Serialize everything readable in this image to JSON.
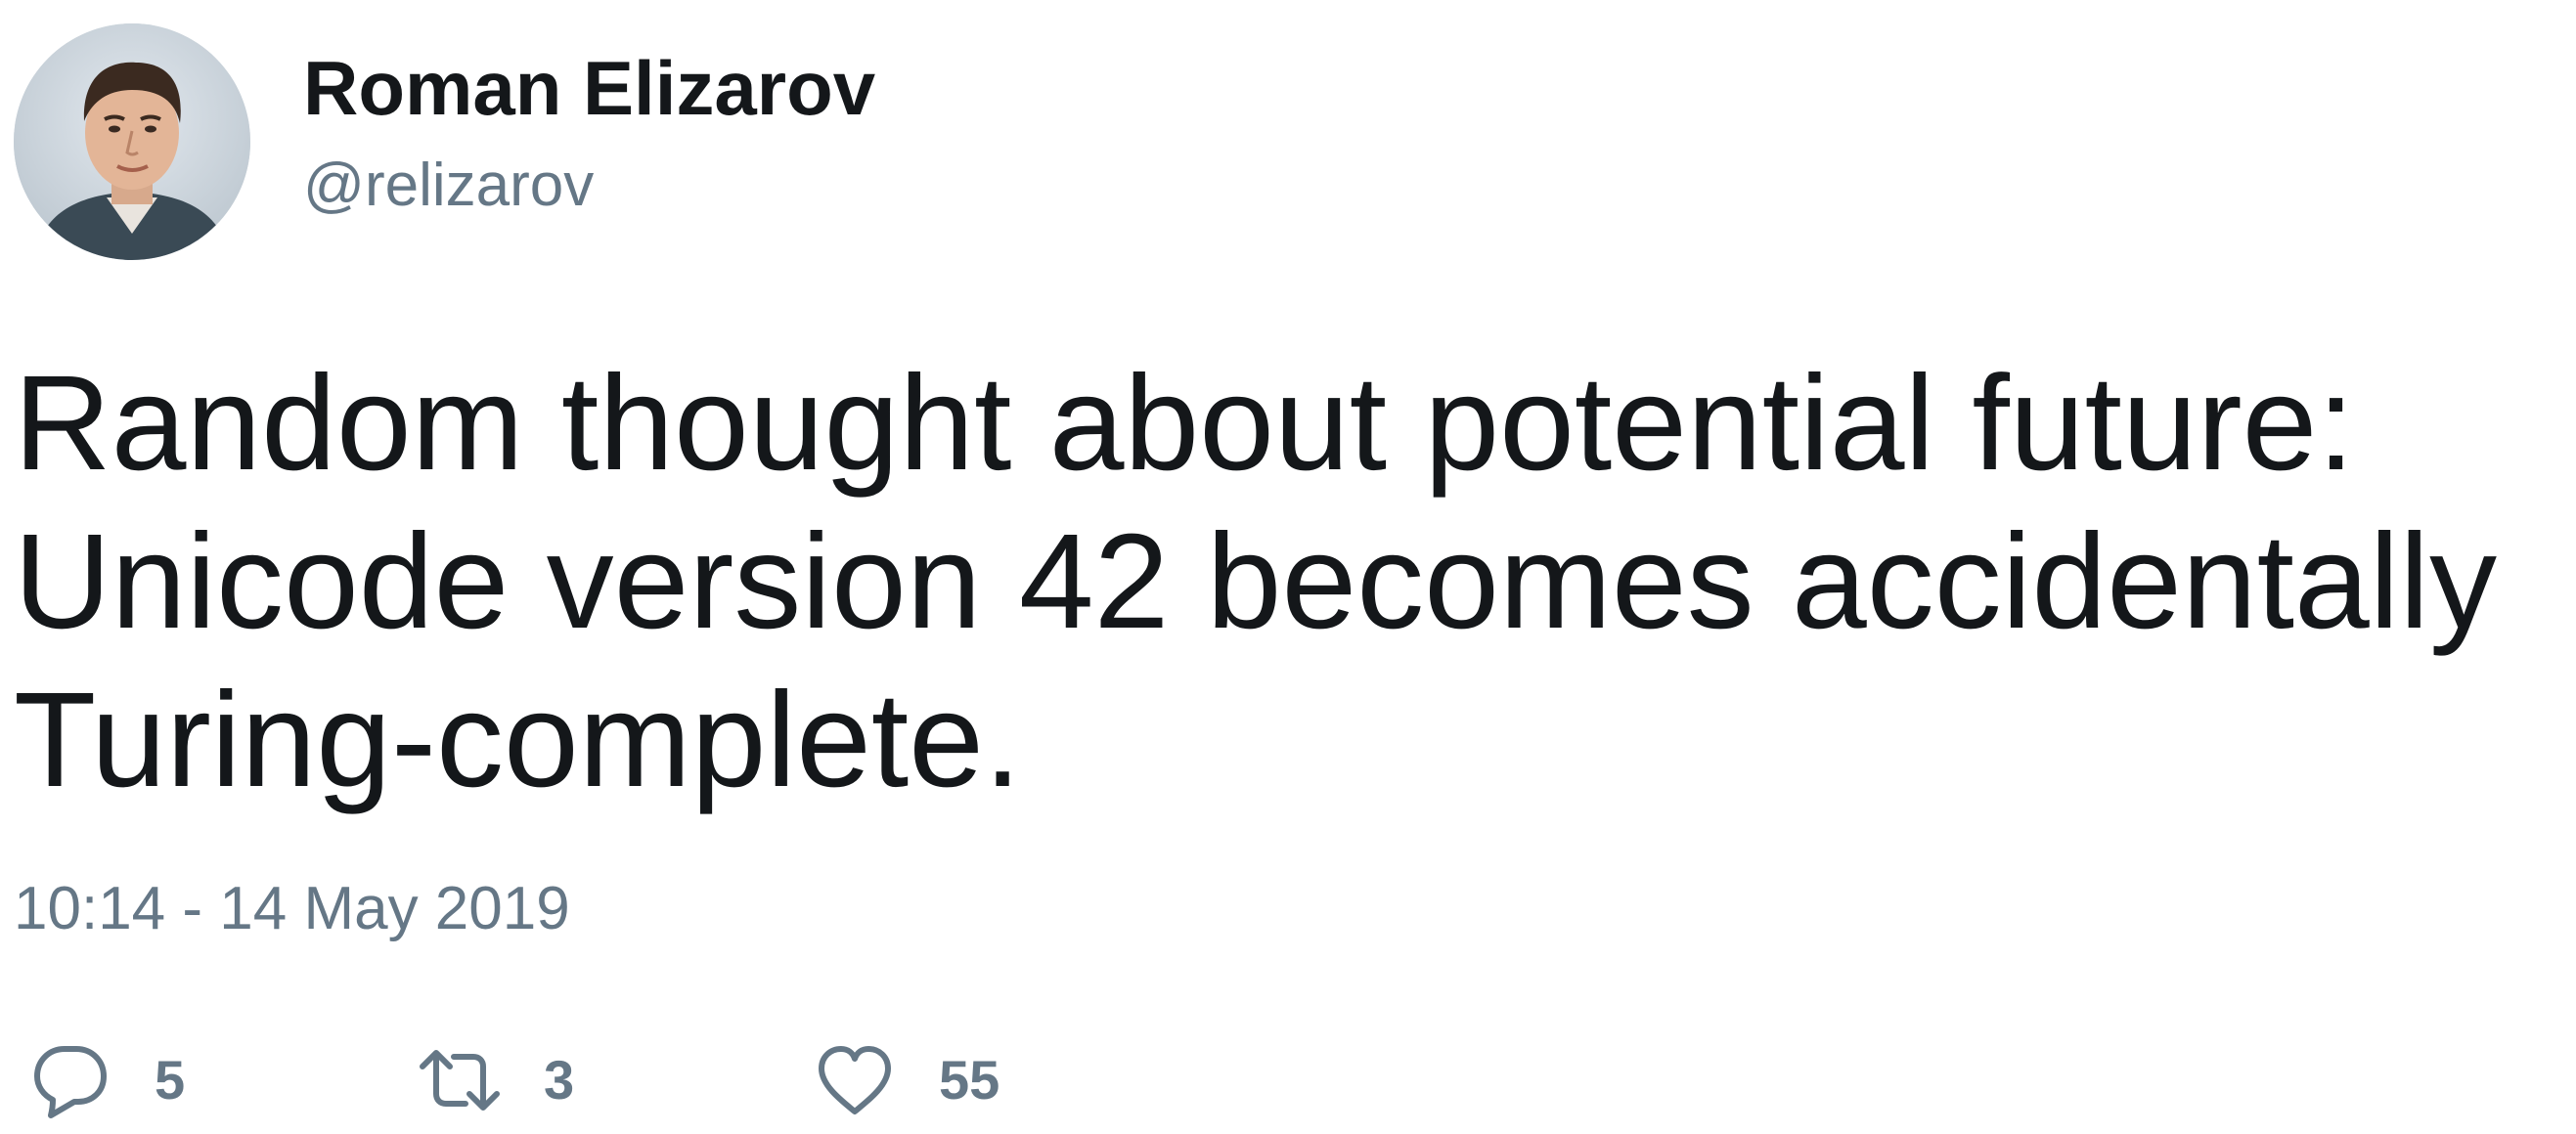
{
  "author": {
    "display_name": "Roman Elizarov",
    "handle": "@relizarov",
    "avatar_icon": "profile-photo"
  },
  "tweet": {
    "text_lines": [
      "Random thought about potential future:",
      "Unicode version 42 becomes accidentally",
      "Turing-complete."
    ],
    "timestamp": "10:14 - 14 May 2019"
  },
  "actions": {
    "reply": {
      "icon": "reply-icon",
      "count": "5"
    },
    "retweet": {
      "icon": "retweet-icon",
      "count": "3"
    },
    "like": {
      "icon": "heart-icon",
      "count": "55"
    }
  },
  "colors": {
    "text": "#14171a",
    "secondary": "#657786"
  }
}
